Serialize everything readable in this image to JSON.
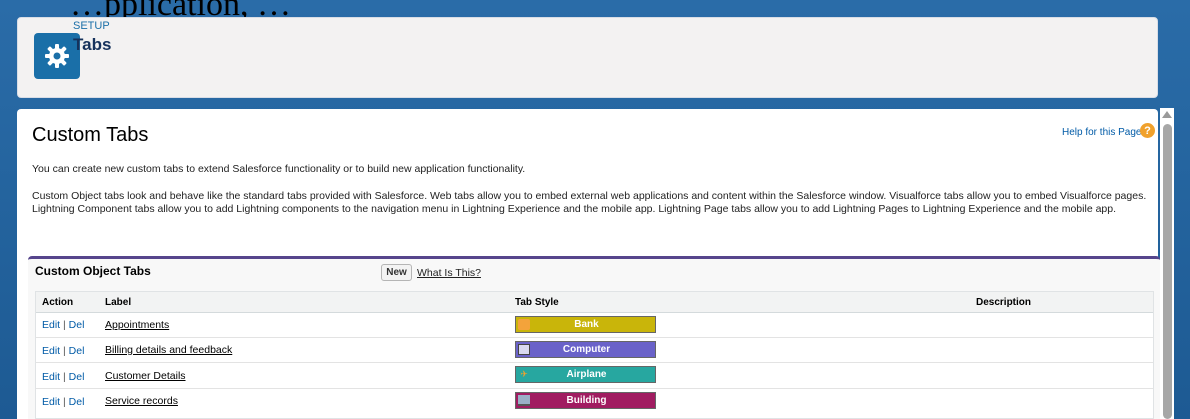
{
  "background_text": "…pplication, …",
  "header": {
    "eyebrow": "SETUP",
    "title": "Tabs",
    "icon": "gear-icon"
  },
  "page": {
    "title": "Custom Tabs",
    "help_link": "Help for this Page",
    "intro": "You can create new custom tabs to extend Salesforce functionality or to build new application functionality.",
    "description": "Custom Object tabs look and behave like the standard tabs provided with Salesforce. Web tabs allow you to embed external web applications and content within the Salesforce window. Visualforce tabs allow you to embed Visualforce pages. Lightning Component tabs allow you to add Lightning components to the navigation menu in Lightning Experience and the mobile app. Lightning Page tabs allow you to add Lightning Pages to Lightning Experience and the mobile app."
  },
  "section": {
    "title": "Custom Object Tabs",
    "new_button": "New",
    "what_link": "What Is This?"
  },
  "table": {
    "columns": [
      "Action",
      "Label",
      "Tab Style",
      "Description"
    ],
    "rows": [
      {
        "edit": "Edit",
        "del": "Del",
        "label": "Appointments",
        "style": "Bank",
        "color": "#c9b50a",
        "icon": "bank-icon",
        "description": ""
      },
      {
        "edit": "Edit",
        "del": "Del",
        "label": "Billing details and feedback",
        "style": "Computer",
        "color": "#6a62c9",
        "icon": "computer-icon",
        "description": ""
      },
      {
        "edit": "Edit",
        "del": "Del",
        "label": "Customer Details",
        "style": "Airplane",
        "color": "#27a7a0",
        "icon": "airplane-icon",
        "description": ""
      },
      {
        "edit": "Edit",
        "del": "Del",
        "label": "Service records",
        "style": "Building",
        "color": "#a11c61",
        "icon": "building-icon",
        "description": ""
      }
    ]
  }
}
